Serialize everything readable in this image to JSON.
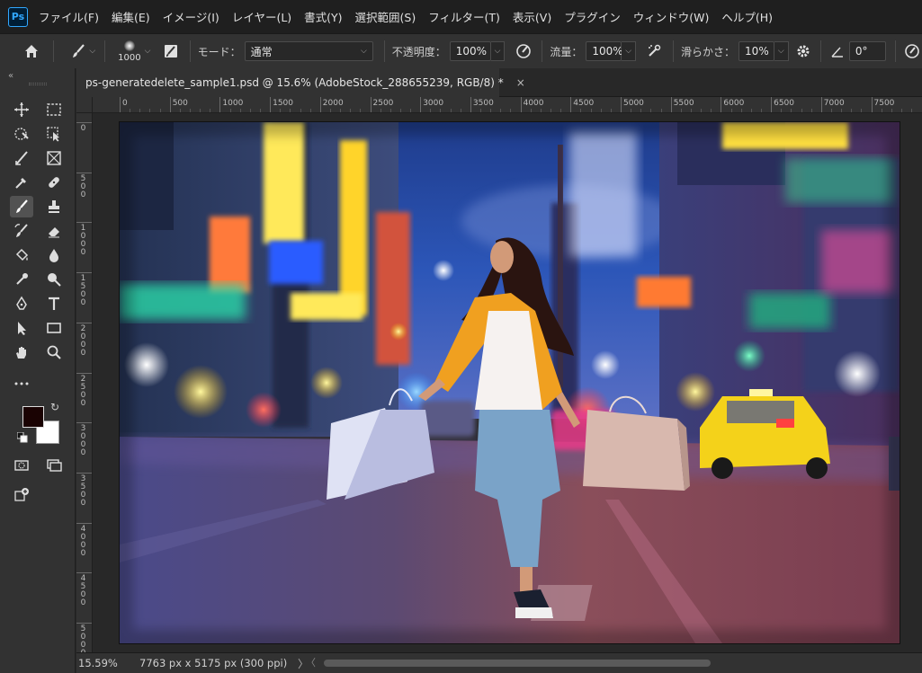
{
  "app": {
    "logo_text": "Ps",
    "menu": [
      "ファイル(F)",
      "編集(E)",
      "イメージ(I)",
      "レイヤー(L)",
      "書式(Y)",
      "選択範囲(S)",
      "フィルター(T)",
      "表示(V)",
      "プラグイン",
      "ウィンドウ(W)",
      "ヘルプ(H)"
    ]
  },
  "options": {
    "brush_size": "1000",
    "mode_label": "モード：",
    "mode_value": "通常",
    "opacity_label": "不透明度：",
    "opacity_value": "100%",
    "flow_label": "流量：",
    "flow_value": "100%",
    "smoothing_label": "滑らかさ：",
    "smoothing_value": "10%",
    "angle_value": "0°"
  },
  "toolbar": {
    "collapse_icon": "«",
    "active_tool": "brush-tool",
    "foreground_color": "#1a0303",
    "background_color": "#ffffff"
  },
  "document": {
    "tab_title": "ps-generatedelete_sample1.psd @ 15.6% (AdobeStock_288655239, RGB/8) *",
    "close_glyph": "×"
  },
  "ruler": {
    "h_labels": [
      "0",
      "500",
      "1000",
      "1500",
      "2000",
      "2500",
      "3000",
      "3500",
      "4000",
      "4500",
      "5000",
      "5500",
      "6000",
      "6500",
      "7000",
      "7500"
    ],
    "v_labels": [
      "0",
      "5\n0\n0",
      "1\n0\n0\n0",
      "1\n5\n0\n0",
      "2\n0\n0\n0",
      "2\n5\n0\n0",
      "3\n0\n0\n0",
      "3\n5\n0\n0",
      "4\n0\n0\n0",
      "4\n5\n0\n0",
      "5\n0\n0\n0"
    ]
  },
  "status": {
    "zoom": "15.59%",
    "doc_info": "7763 px x 5175 px (300 ppi)",
    "arrow": "〉",
    "scroll_left": "〈"
  }
}
